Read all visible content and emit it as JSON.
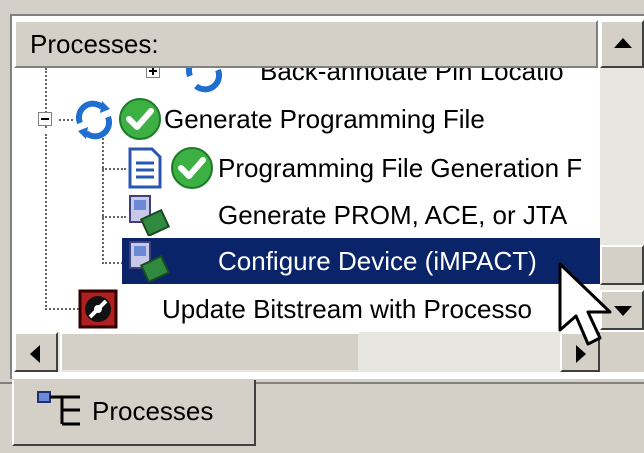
{
  "header": {
    "title": "Processes:"
  },
  "tree": {
    "rows": [
      {
        "label": "Back-annotate Pin Locatio",
        "icon": "refresh-icon"
      },
      {
        "label": "Generate Programming File",
        "icon": "refresh-icon"
      },
      {
        "label": "Programming File Generation F",
        "icon": "document-icon"
      },
      {
        "label": "Generate PROM, ACE, or JTA",
        "icon": "device-tool-icon"
      },
      {
        "label": "Configure Device (iMPACT)",
        "icon": "device-tool-icon",
        "selected": true
      },
      {
        "label": "Update Bitstream with Processo",
        "icon": "processor-icon"
      }
    ]
  },
  "tabs": [
    {
      "label": "Processes",
      "icon": "process-tree-icon",
      "active": true
    }
  ],
  "colors": {
    "selection": "#0a246a",
    "face": "#d4d0c8",
    "status_ok": "#3cb043"
  }
}
